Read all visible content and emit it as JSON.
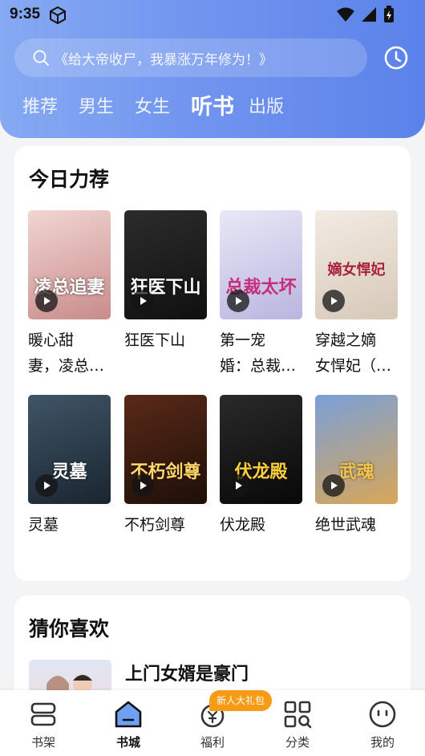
{
  "status_bar": {
    "time": "9:35"
  },
  "search": {
    "placeholder": "《给大帝收尸，我暴涨万年修为！》"
  },
  "tabs": [
    {
      "label": "推荐"
    },
    {
      "label": "男生"
    },
    {
      "label": "女生"
    },
    {
      "label": "听书",
      "active": true
    },
    {
      "label": "出版"
    }
  ],
  "recommend": {
    "title": "今日力荐",
    "books": [
      {
        "name": "暖心甜妻，凌总…",
        "line1": "暖心甜",
        "line2": "妻，凌总…",
        "cover_text": "凌总追妻",
        "colors": [
          "#f1d6d2",
          "#c98b8b"
        ]
      },
      {
        "name": "狂医下山",
        "line1": "狂医下山",
        "line2": "",
        "cover_text": "狂医下山",
        "colors": [
          "#2c2c2c",
          "#101010"
        ]
      },
      {
        "name": "第一宠婚：总裁…",
        "line1": "第一宠",
        "line2": "婚：总裁…",
        "cover_text": "总裁太坏",
        "colors": [
          "#e8e8f6",
          "#b9b5e0"
        ]
      },
      {
        "name": "穿越之嫡女悍妃（…",
        "line1": "穿越之嫡",
        "line2": "女悍妃（…",
        "cover_text": "嫡女悍妃",
        "colors": [
          "#f2ece4",
          "#d7c8b8"
        ]
      },
      {
        "name": "灵墓",
        "line1": "灵墓",
        "line2": "",
        "cover_text": "灵墓",
        "colors": [
          "#3f5567",
          "#1a2530"
        ]
      },
      {
        "name": "不朽剑尊",
        "line1": "不朽剑尊",
        "line2": "",
        "cover_text": "不朽剑尊",
        "colors": [
          "#5a2a18",
          "#1e0e08"
        ]
      },
      {
        "name": "伏龙殿",
        "line1": "伏龙殿",
        "line2": "",
        "cover_text": "伏龙殿",
        "colors": [
          "#2a2a2a",
          "#080808"
        ]
      },
      {
        "name": "绝世武魂",
        "line1": "绝世武魂",
        "line2": "",
        "cover_text": "武魂",
        "colors": [
          "#7aa0d8",
          "#d8a658"
        ]
      }
    ]
  },
  "guess": {
    "title": "猜你喜欢",
    "first_book": "上门女婿是豪门"
  },
  "bottom_nav": [
    {
      "label": "书架",
      "icon": "bookshelf-icon"
    },
    {
      "label": "书城",
      "icon": "bookstore-icon",
      "active": true
    },
    {
      "label": "福利",
      "icon": "welfare-icon"
    },
    {
      "label": "分类",
      "icon": "category-icon"
    },
    {
      "label": "我的",
      "icon": "profile-icon"
    }
  ],
  "gift_badge": "新人大礼包",
  "colors": {
    "accent": "#6f93ee",
    "badge": "#f79a16"
  }
}
